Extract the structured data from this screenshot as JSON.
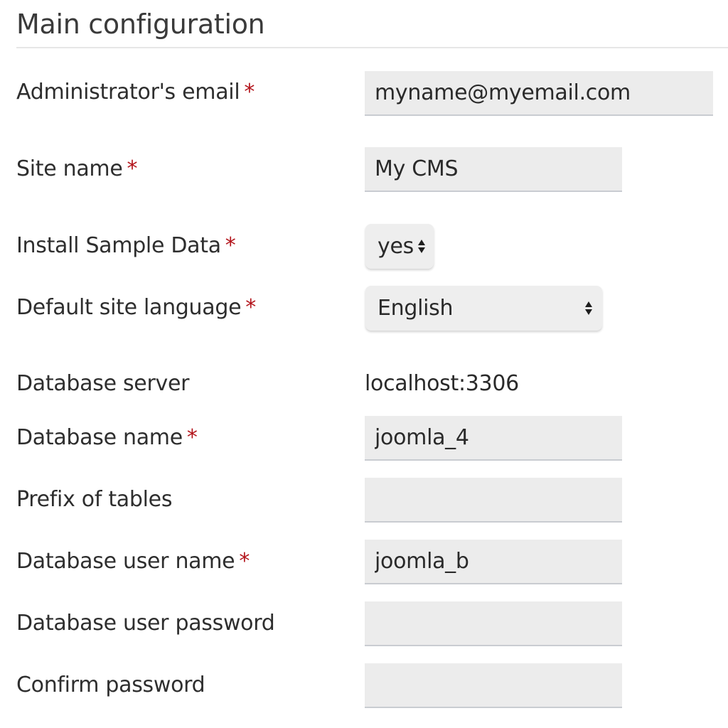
{
  "section": {
    "title": "Main configuration"
  },
  "required_marker": "*",
  "fields": {
    "admin_email": {
      "label": "Administrator's email",
      "value": "myname@myemail.com"
    },
    "site_name": {
      "label": "Site name",
      "value": "My CMS"
    },
    "sample_data": {
      "label": "Install Sample Data",
      "selected": "yes"
    },
    "site_language": {
      "label": "Default site language",
      "selected": "English"
    },
    "db_server": {
      "label": "Database server",
      "value": "localhost:3306"
    },
    "db_name": {
      "label": "Database name",
      "value": "joomla_4"
    },
    "table_prefix": {
      "label": "Prefix of tables",
      "value": ""
    },
    "db_user": {
      "label": "Database user name",
      "value": "joomla_b"
    },
    "db_password": {
      "label": "Database user password",
      "value": ""
    },
    "confirm_password": {
      "label": "Confirm password",
      "value": ""
    }
  },
  "colors": {
    "required": "#b3141b",
    "field_bg": "#ececec",
    "field_border": "#c9ccd1"
  },
  "icons": {
    "select_arrows": "up-down-chevron-icon"
  }
}
